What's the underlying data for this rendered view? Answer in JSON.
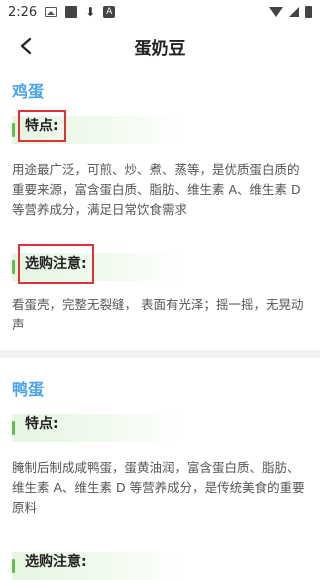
{
  "status_bar": {
    "time": "2:26"
  },
  "header": {
    "title": "蛋奶豆"
  },
  "sections": [
    {
      "name": "鸡蛋",
      "feature_label": "特点:",
      "feature_text": "用途最广泛，可煎、炒、煮、蒸等，是优质蛋白质的重要来源，富含蛋白质、脂肪、维生素 A、维生素 D 等营养成分，满足日常饮食需求",
      "tips_label": "选购注意:",
      "tips_text": "看蛋壳，完整无裂缝， 表面有光泽；摇一摇，无晃动声"
    },
    {
      "name": "鸭蛋",
      "feature_label": "特点:",
      "feature_text": "腌制后制成咸鸭蛋，蛋黄油润，富含蛋白质、脂肪、维生素 A、维生素 D 等营养成分，是传统美食的重要原料",
      "tips_label": "选购注意:"
    }
  ],
  "colors": {
    "accent_blue": "#4ba3e8",
    "accent_green": "#5cc24a",
    "highlight_red": "#dd3333"
  }
}
